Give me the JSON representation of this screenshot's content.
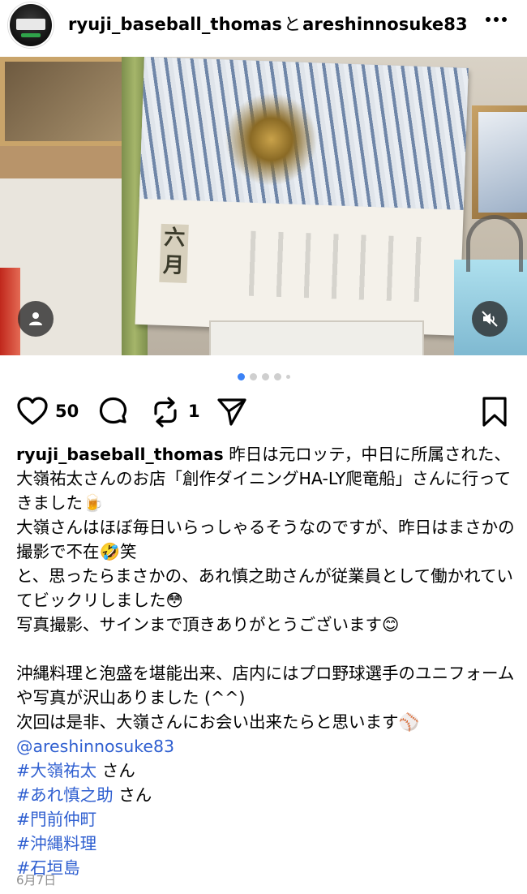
{
  "header": {
    "user1": "ryuji_baseball_thomas",
    "separator": "と",
    "user2": "areshinnosuke83",
    "more_label": "•••"
  },
  "photo": {
    "calendar_month": "六月",
    "carousel": {
      "count": 5,
      "active_index": 0
    }
  },
  "actions": {
    "likes": "50",
    "reposts": "1"
  },
  "caption": {
    "author": "ryuji_baseball_thomas",
    "line1": " 昨日は元ロッテ，中日に所属された、大嶺祐太さんのお店「創作ダイニングHA-LY爬竜船」さんに行ってきました🍺",
    "line2": "大嶺さんはほぼ毎日いらっしゃるそうなのですが、昨日はまさかの撮影で不在🤣笑",
    "line3": "と、思ったらまさかの、あれ慎之助さんが従業員として働かれていてビックリしました😳",
    "line4": "写真撮影、サインまで頂きありがとうございます😊",
    "line5": "沖縄料理と泡盛を堪能出来、店内にはプロ野球選手のユニフォームや写真が沢山ありました (^^)",
    "line6": "次回は是非、大嶺さんにお会い出来たらと思います⚾",
    "mention": "@areshinnosuke83",
    "tags": [
      {
        "tag": "#大嶺祐太",
        "suffix": " さん"
      },
      {
        "tag": "#あれ慎之助",
        "suffix": " さん"
      },
      {
        "tag": "#門前仲町",
        "suffix": ""
      },
      {
        "tag": "#沖縄料理",
        "suffix": ""
      },
      {
        "tag": "#石垣島",
        "suffix": ""
      }
    ]
  },
  "date": "6月7日",
  "colors": {
    "link": "#2f5fd0",
    "dot_active": "#3b82f6",
    "dot_inactive": "#cfcfcf",
    "date_gray": "#8e8e8e"
  },
  "icons": [
    "avatar",
    "more-icon",
    "user-tag-icon",
    "mute-icon",
    "heart-icon",
    "comment-icon",
    "repost-icon",
    "share-icon",
    "bookmark-icon"
  ]
}
